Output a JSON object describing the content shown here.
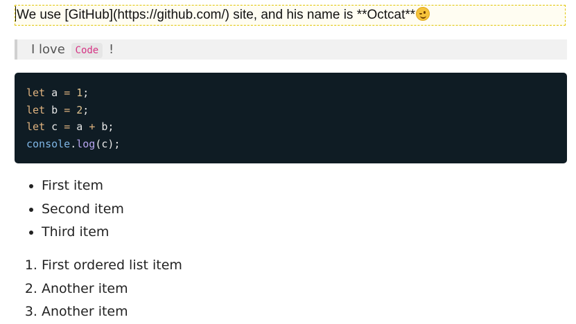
{
  "editor": {
    "line_text": "We use [GitHub](https://github.com/) site, and his name is  **Octcat**",
    "emoji": "wink-emoji"
  },
  "blockquote": {
    "before": "I love",
    "code": "Code",
    "after": "!"
  },
  "code_block": {
    "lines": [
      [
        {
          "t": "let",
          "c": "kw"
        },
        {
          "t": " a ",
          "c": ""
        },
        {
          "t": "=",
          "c": "op"
        },
        {
          "t": " ",
          "c": ""
        },
        {
          "t": "1",
          "c": "num"
        },
        {
          "t": ";",
          "c": ""
        }
      ],
      [
        {
          "t": "let",
          "c": "kw"
        },
        {
          "t": " b ",
          "c": ""
        },
        {
          "t": "=",
          "c": "op"
        },
        {
          "t": " ",
          "c": ""
        },
        {
          "t": "2",
          "c": "num"
        },
        {
          "t": ";",
          "c": ""
        }
      ],
      [
        {
          "t": "let",
          "c": "kw"
        },
        {
          "t": " c ",
          "c": ""
        },
        {
          "t": "=",
          "c": "op"
        },
        {
          "t": " a ",
          "c": ""
        },
        {
          "t": "+",
          "c": "op"
        },
        {
          "t": " b;",
          "c": ""
        }
      ],
      [
        {
          "t": "console",
          "c": "obj"
        },
        {
          "t": ".",
          "c": ""
        },
        {
          "t": "log",
          "c": "fn"
        },
        {
          "t": "(c);",
          "c": ""
        }
      ]
    ]
  },
  "bullet_list": [
    "First item",
    "Second item",
    "Third item"
  ],
  "ordered_list": [
    "First ordered list item",
    "Another item",
    "Another item"
  ],
  "colors": {
    "code_bg": "#0f1c24",
    "keyword": "#e0b37f",
    "object": "#7fb6e6",
    "function": "#b6a4ef",
    "inline_code": "#d63384",
    "blockquote_bg": "#f1f1f1",
    "editor_border": "#e0c400"
  }
}
